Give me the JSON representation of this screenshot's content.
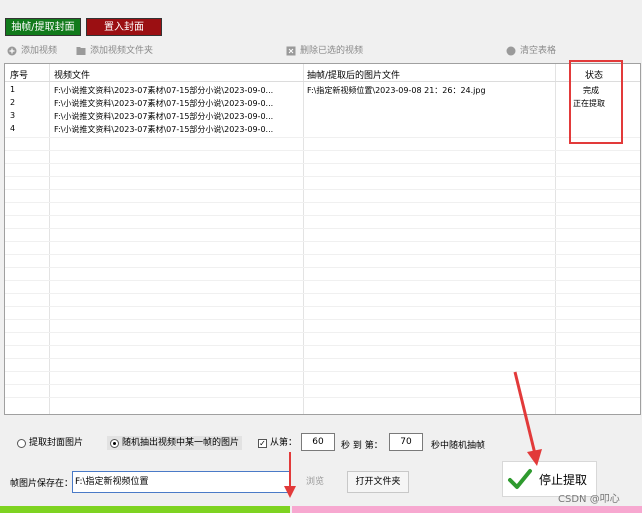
{
  "top_tabs": {
    "extract": "抽帧/提取封面",
    "insert": "置入封面"
  },
  "toolbar": {
    "add_video": "添加视频",
    "add_folder": "添加视频文件夹",
    "remove_selected": "删除已选的视频",
    "clear_table": "清空表格"
  },
  "table": {
    "headers": {
      "index": "序号",
      "video": "视频文件",
      "output": "抽帧/提取后的图片文件",
      "status": "状态"
    },
    "rows": [
      {
        "index": "1",
        "video": "F:\\小说推文资料\\2023-07素材\\07-15部分小说\\2023-09-0...",
        "output": "F:\\指定新视频位置\\2023-09-08 21：26：24.jpg",
        "status": "完成"
      },
      {
        "index": "2",
        "video": "F:\\小说推文资料\\2023-07素材\\07-15部分小说\\2023-09-0...",
        "output": "",
        "status": "正在提取"
      },
      {
        "index": "3",
        "video": "F:\\小说推文资料\\2023-07素材\\07-15部分小说\\2023-09-0...",
        "output": "",
        "status": ""
      },
      {
        "index": "4",
        "video": "F:\\小说推文资料\\2023-07素材\\07-15部分小说\\2023-09-0...",
        "output": "",
        "status": ""
      }
    ]
  },
  "options": {
    "cover_label": "提取封面图片",
    "random_label": "随机抽出视频中某一帧的图片",
    "from_label": "从第：",
    "from_value": "60",
    "to_label": "秒 到 第：",
    "to_value": "70",
    "suffix": "秒中随机抽帧"
  },
  "save": {
    "label": "帧图片保存在：",
    "path": "F:\\指定新视频位置",
    "browse": "浏览",
    "open_folder": "打开文件夹"
  },
  "stop_button": "停止提取",
  "watermark": "CSDN @叩心",
  "colors": {
    "extract_tab": "#117a1b",
    "insert_tab": "#9b0f12",
    "highlight": "#e23a3a",
    "progress_green": "#7ed321",
    "progress_pink": "#f7a8d0"
  }
}
